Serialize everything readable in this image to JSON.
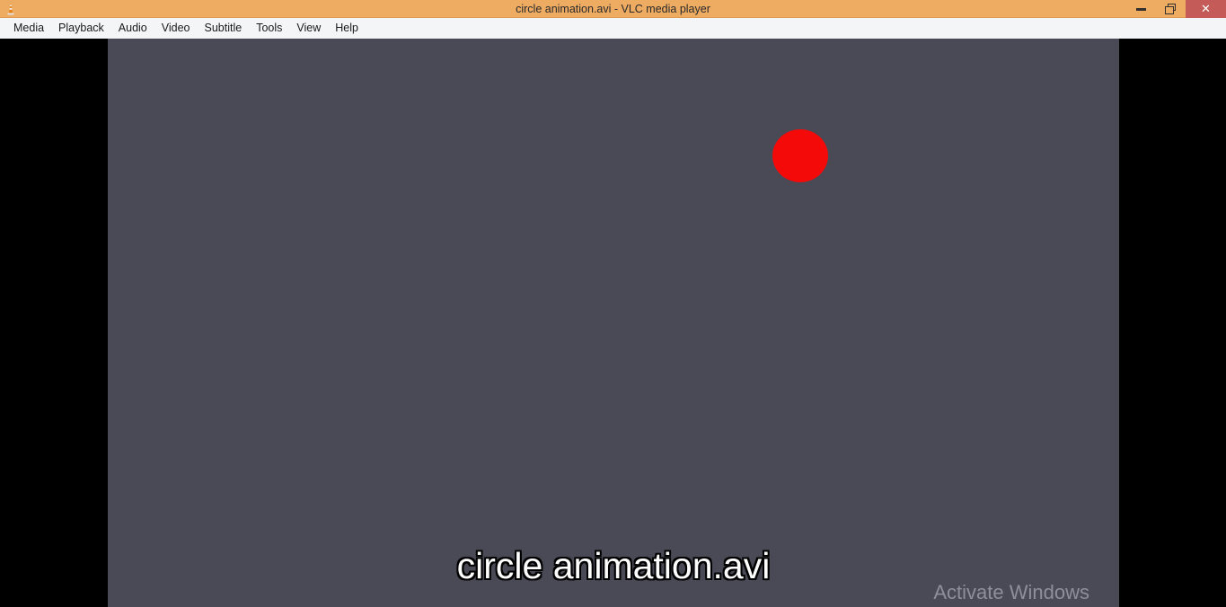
{
  "window": {
    "title": "circle animation.avi - VLC media player",
    "icon": "vlc-cone-icon",
    "controls": {
      "minimize_label": "─",
      "restore_label": "❐",
      "close_label": "✕"
    },
    "colors": {
      "titlebar": "#eeab62",
      "close_button": "#c55b58",
      "menubar": "#f4f5f7",
      "letterbox": "#000000",
      "video_background": "#494a55",
      "circle": "#f50a0a",
      "watermark_text": "#8d8f99"
    }
  },
  "menubar": {
    "items": [
      {
        "label": "Media"
      },
      {
        "label": "Playback"
      },
      {
        "label": "Audio"
      },
      {
        "label": "Video"
      },
      {
        "label": "Subtitle"
      },
      {
        "label": "Tools"
      },
      {
        "label": "View"
      },
      {
        "label": "Help"
      }
    ]
  },
  "video": {
    "subtitle_text": "circle animation.avi",
    "shape": {
      "name": "red-circle",
      "color": "#f50a0a"
    }
  },
  "overlay": {
    "activation_watermark": "Activate Windows"
  }
}
